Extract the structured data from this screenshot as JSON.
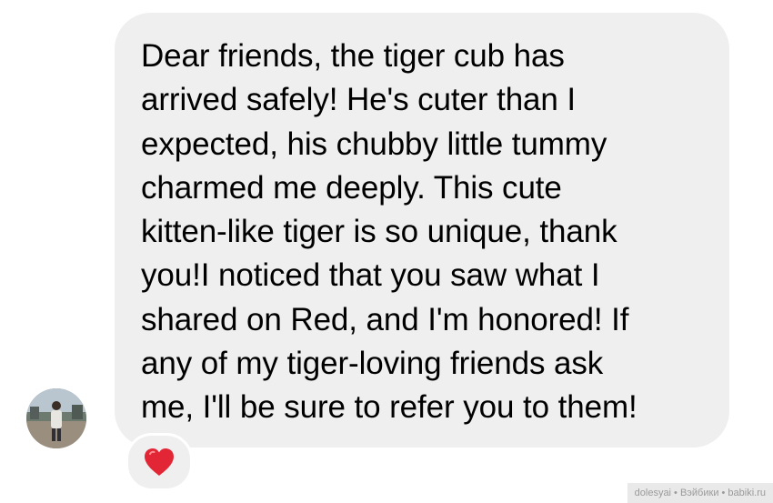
{
  "message": {
    "lines": [
      "Dear friends, the tiger cub has",
      "arrived safely! He's cuter than I",
      "expected, his chubby little tummy",
      "charmed me deeply. This cute",
      "kitten-like tiger is so unique, thank",
      "you!I noticed that you saw what I",
      "shared on Red, and I'm honored! If",
      "any of my tiger-loving friends ask",
      "me, I'll be sure to refer you to them!"
    ]
  },
  "reaction": {
    "icon": "heart-icon",
    "color": "#e32636"
  },
  "watermark": {
    "text": "dolesyai • Вэйбики • babiki.ru"
  },
  "colors": {
    "bubble_background": "#efefef",
    "text": "#000000",
    "page_background": "#ffffff"
  }
}
